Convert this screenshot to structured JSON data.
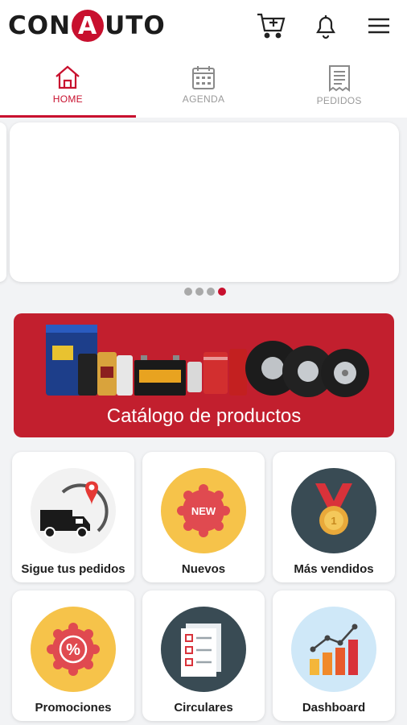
{
  "app": {
    "logo_left": "CON",
    "logo_badge": "A",
    "logo_right": "UTO"
  },
  "header_icons": [
    {
      "name": "cart-icon"
    },
    {
      "name": "bell-icon"
    },
    {
      "name": "menu-icon"
    }
  ],
  "tabs": [
    {
      "label": "HOME",
      "active": true
    },
    {
      "label": "AGENDA",
      "active": false
    },
    {
      "label": "PEDIDOS",
      "active": false
    }
  ],
  "carousel": {
    "dots": 4,
    "active_index": 3
  },
  "catalog": {
    "title": "Catálogo de productos"
  },
  "menu": [
    {
      "label": "Sigue tus pedidos",
      "icon": "delivery-truck-icon",
      "bg": "#f2f2f2"
    },
    {
      "label": "Nuevos",
      "icon": "new-badge-icon",
      "bg": "#f6c34a"
    },
    {
      "label": "Más vendidos",
      "icon": "medal-icon",
      "bg": "#394b54"
    },
    {
      "label": "Promociones",
      "icon": "percent-badge-icon",
      "bg": "#f6c34a"
    },
    {
      "label": "Circulares",
      "icon": "checklist-icon",
      "bg": "#394b54"
    },
    {
      "label": "Dashboard",
      "icon": "bar-chart-icon",
      "bg": "#cfe8f8"
    }
  ],
  "colors": {
    "accent": "#c8102e",
    "banner": "#c21f2e"
  }
}
